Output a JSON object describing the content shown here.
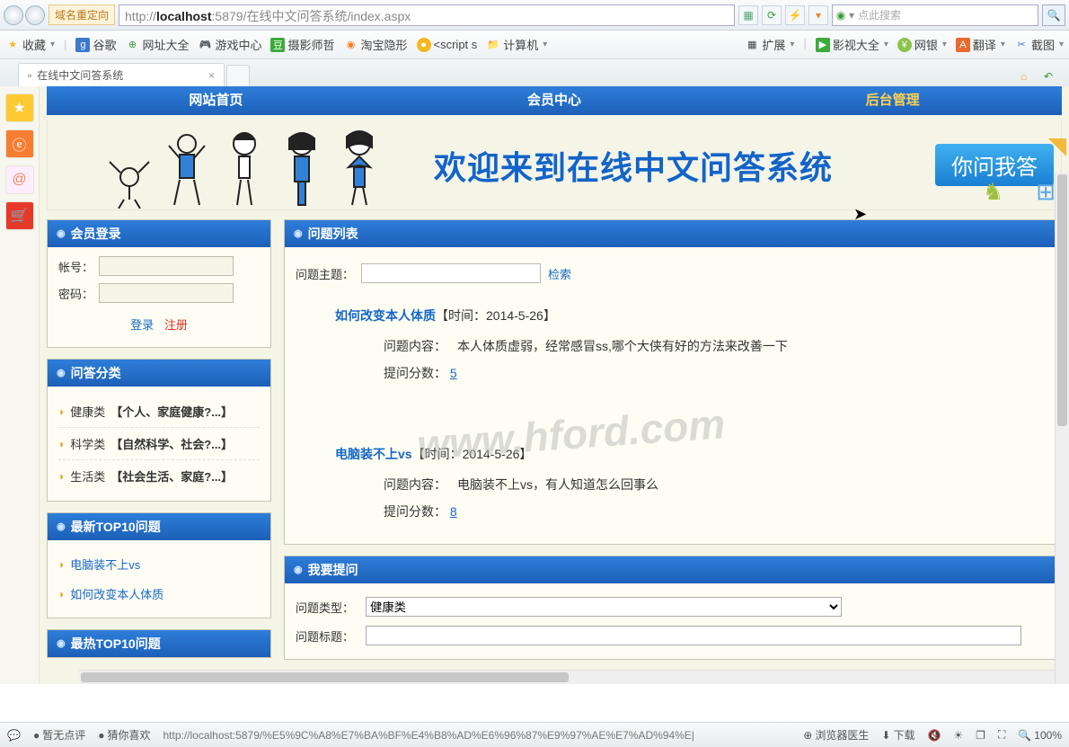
{
  "browser": {
    "addr_label": "域名重定向",
    "url_prefix": "http://",
    "url_host": "localhost",
    "url_rest": ":5879/在线中文问答系统/index.aspx",
    "search_placeholder": "点此搜索"
  },
  "bookmarks": {
    "fav": "收藏",
    "items": [
      "谷歌",
      "网址大全",
      "游戏中心",
      "摄影师哲",
      "淘宝隐形",
      "<script s",
      "计算机"
    ],
    "right": [
      "扩展",
      "影视大全",
      "网银",
      "翻译",
      "截图"
    ]
  },
  "tab": {
    "title": "在线中文问答系统"
  },
  "nav": {
    "home": "网站首页",
    "member": "会员中心",
    "admin": "后台管理"
  },
  "banner": {
    "welcome": "欢迎来到在线中文问答系统",
    "ask": "你问我答"
  },
  "login": {
    "title": "会员登录",
    "user_label": "帐号：",
    "pass_label": "密码：",
    "login": "登录",
    "register": "注册"
  },
  "category": {
    "title": "问答分类",
    "items": [
      {
        "name": "健康类",
        "desc": "【个人、家庭健康?...】"
      },
      {
        "name": "科学类",
        "desc": "【自然科学、社会?...】"
      },
      {
        "name": "生活类",
        "desc": "【社会生活、家庭?...】"
      }
    ]
  },
  "top10": {
    "title": "最新TOP10问题",
    "items": [
      "电脑装不上vs",
      "如何改变本人体质"
    ],
    "title2": "最热TOP10问题"
  },
  "qlist": {
    "title": "问题列表",
    "search_label": "问题主题：",
    "search_btn": "检索",
    "items": [
      {
        "title": "如何改变本人体质",
        "time": "【时间：2014-5-26】",
        "content_lbl": "问题内容：",
        "content": "本人体质虚弱，经常感冒ss,哪个大侠有好的方法来改善一下",
        "points_lbl": "提问分数：",
        "points": "5"
      },
      {
        "title": "电脑装不上vs",
        "time": "【时间：2014-5-26】",
        "content_lbl": "问题内容：",
        "content": "电脑装不上vs，有人知道怎么回事么",
        "points_lbl": "提问分数：",
        "points": "8"
      }
    ]
  },
  "askform": {
    "title": "我要提问",
    "type_label": "问题类型：",
    "type_value": "健康类",
    "subject_label": "问题标题："
  },
  "status": {
    "no_comment": "暂无点评",
    "guess": "猜你喜欢",
    "url": "http://localhost:5879/%E5%9C%A8%E7%BA%BF%E4%B8%AD%E6%96%87%E9%97%AE%E7%AD%94%E|",
    "doctor": "浏览器医生",
    "download": "下载",
    "zoom": "100%"
  },
  "watermark": "www.hford.com"
}
